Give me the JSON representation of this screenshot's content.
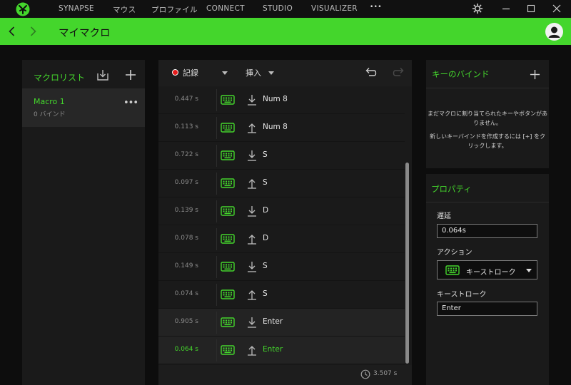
{
  "nav": {
    "tabs": [
      "SYNAPSE",
      "マウス",
      "プロファイル",
      "CONNECT",
      "STUDIO",
      "VISUALIZER"
    ],
    "more_label": "•••"
  },
  "header": {
    "title": "マイマクロ"
  },
  "macro_list": {
    "title": "マクロリスト",
    "items": [
      {
        "name": "Macro 1",
        "binds": "0 バインド"
      }
    ]
  },
  "editor": {
    "record_label": "記録",
    "insert_label": "挿入",
    "rows": [
      {
        "time": "0.447 s",
        "direction": "down",
        "key": "Num 8",
        "active": false
      },
      {
        "time": "0.113 s",
        "direction": "up",
        "key": "Num 8",
        "active": false
      },
      {
        "time": "0.722 s",
        "direction": "down",
        "key": "S",
        "active": false
      },
      {
        "time": "0.097 s",
        "direction": "up",
        "key": "S",
        "active": false
      },
      {
        "time": "0.139 s",
        "direction": "down",
        "key": "D",
        "active": false
      },
      {
        "time": "0.078 s",
        "direction": "up",
        "key": "D",
        "active": false
      },
      {
        "time": "0.149 s",
        "direction": "down",
        "key": "S",
        "active": false
      },
      {
        "time": "0.074 s",
        "direction": "up",
        "key": "S",
        "active": false
      },
      {
        "time": "0.905 s",
        "direction": "down",
        "key": "Enter",
        "active": false
      },
      {
        "time": "0.064 s",
        "direction": "up",
        "key": "Enter",
        "active": true
      }
    ],
    "total_time": "3.507 s"
  },
  "key_binds": {
    "title": "キーのバインド",
    "message_1a": "まだマクロに割り当てられたキーやボタンがあ",
    "message_1b": "りません。",
    "message_2a": "新しいキーバインドを作成するには [+] をク",
    "message_2b": "リックします。"
  },
  "properties": {
    "title": "プロパティ",
    "delay_label": "遅延",
    "delay_value": "0.064s",
    "action_label": "アクション",
    "action_value": "キーストローク",
    "keystroke_label": "キーストローク",
    "keystroke_value": "Enter"
  },
  "colors": {
    "accent": "#44d62c",
    "record": "#e51c1c",
    "background": "#0d0d0d",
    "panel": "#1a1a1a"
  }
}
